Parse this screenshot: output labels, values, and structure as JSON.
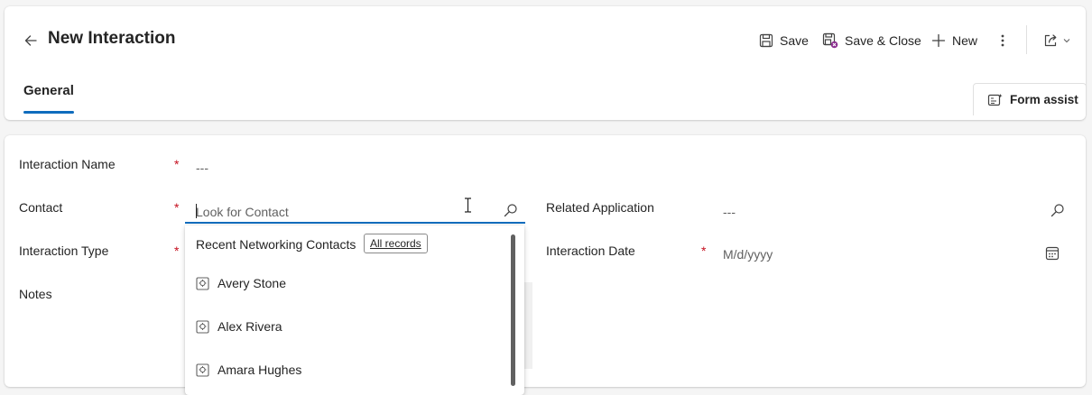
{
  "header": {
    "title": "New Interaction",
    "commands": {
      "save": "Save",
      "save_close": "Save & Close",
      "new": "New"
    },
    "tabs": [
      {
        "label": "General",
        "active": true
      }
    ],
    "form_assist": "Form assist"
  },
  "form": {
    "fields": {
      "interaction_name": {
        "label": "Interaction Name",
        "required": "*",
        "value": "---"
      },
      "contact": {
        "label": "Contact",
        "required": "*",
        "placeholder": "Look for Contact"
      },
      "related_application": {
        "label": "Related Application",
        "value": "---"
      },
      "interaction_type": {
        "label": "Interaction Type",
        "required": "*"
      },
      "interaction_date": {
        "label": "Interaction Date",
        "required": "*",
        "placeholder": "M/d/yyyy"
      },
      "notes": {
        "label": "Notes"
      }
    }
  },
  "lookup_dropdown": {
    "heading": "Recent Networking Contacts",
    "all_records": "All records",
    "items": [
      {
        "name": "Avery Stone",
        "icon": "contact-record-icon"
      },
      {
        "name": "Alex Rivera",
        "icon": "contact-record-icon"
      },
      {
        "name": "Amara Hughes",
        "icon": "contact-record-icon"
      }
    ]
  },
  "colors": {
    "accent": "#0f6cbd",
    "required": "#c50f1f",
    "text": "#242424",
    "muted": "#616161"
  }
}
